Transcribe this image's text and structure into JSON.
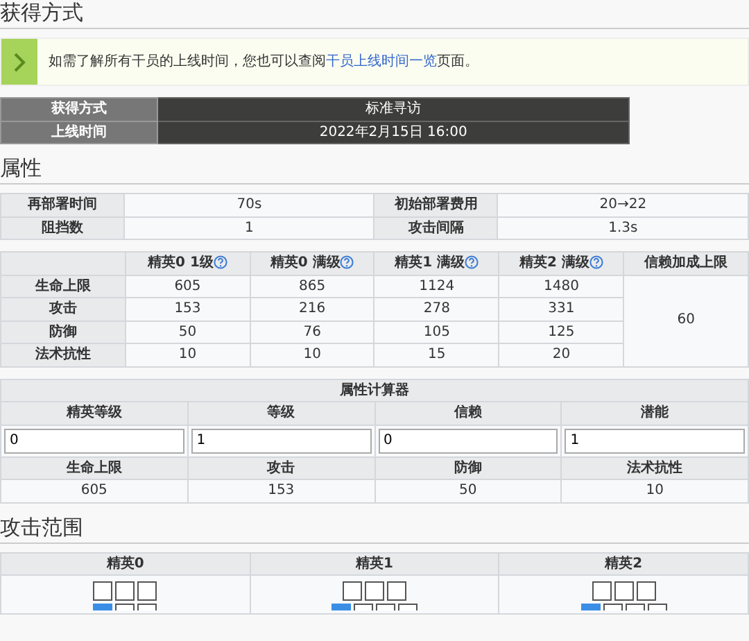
{
  "sections": [
    {
      "title": "获得方式"
    },
    {
      "title": "属性"
    },
    {
      "title": "攻击范围"
    }
  ],
  "notice": {
    "text": "如需了解所有干员的上线时间，您也可以查阅",
    "link": "干员上线时间一览",
    "after": "页面。"
  },
  "obtain": [
    {
      "label": "获得方式",
      "value": "标准寻访"
    },
    {
      "label": "上线时间",
      "value": "2022年2月15日 16:00"
    }
  ],
  "attributes": [
    [
      "再部署时间",
      "70s",
      "初始部署费用",
      "20→22"
    ],
    [
      "阻挡数",
      "1",
      "攻击间隔",
      "1.3s"
    ]
  ],
  "stats": {
    "columns": [
      "精英0 1级",
      "精英0 满级",
      "精英1 满级",
      "精英2 满级",
      "信赖加成上限"
    ],
    "help": [
      true,
      true,
      true,
      true,
      false
    ],
    "rows": [
      {
        "label": "生命上限",
        "values": [
          "605",
          "865",
          "1124",
          "1480"
        ]
      },
      {
        "label": "攻击",
        "values": [
          "153",
          "216",
          "278",
          "331"
        ]
      },
      {
        "label": "防御",
        "values": [
          "50",
          "76",
          "105",
          "125"
        ]
      },
      {
        "label": "法术抗性",
        "values": [
          "10",
          "10",
          "15",
          "20"
        ]
      }
    ],
    "trust": "60"
  },
  "calculator": {
    "title": "属性计算器",
    "inputs": [
      {
        "label": "精英等级",
        "value": "0"
      },
      {
        "label": "等级",
        "value": "1"
      },
      {
        "label": "信赖",
        "value": "0"
      },
      {
        "label": "潜能",
        "value": "1"
      }
    ],
    "results": [
      {
        "label": "生命上限",
        "value": "605"
      },
      {
        "label": "攻击",
        "value": "153"
      },
      {
        "label": "防御",
        "value": "50"
      },
      {
        "label": "法术抗性",
        "value": "10"
      }
    ]
  },
  "ranges": [
    {
      "label": "精英0",
      "grid": [
        [
          {
            "self": false
          },
          {
            "self": false
          },
          {
            "self": false
          }
        ],
        [
          {
            "self": true
          },
          {
            "self": false
          },
          {
            "self": false
          }
        ]
      ]
    },
    {
      "label": "精英1",
      "grid": [
        [
          {
            "self": false
          },
          {
            "self": false
          },
          {
            "self": false
          }
        ],
        [
          {
            "self": true
          },
          {
            "self": false
          },
          {
            "self": false
          },
          {
            "self": false
          }
        ]
      ]
    },
    {
      "label": "精英2",
      "grid": [
        [
          {
            "self": false
          },
          {
            "self": false
          },
          {
            "self": false
          }
        ],
        [
          {
            "self": true
          },
          {
            "self": false
          },
          {
            "self": false
          },
          {
            "self": false
          }
        ]
      ]
    }
  ]
}
